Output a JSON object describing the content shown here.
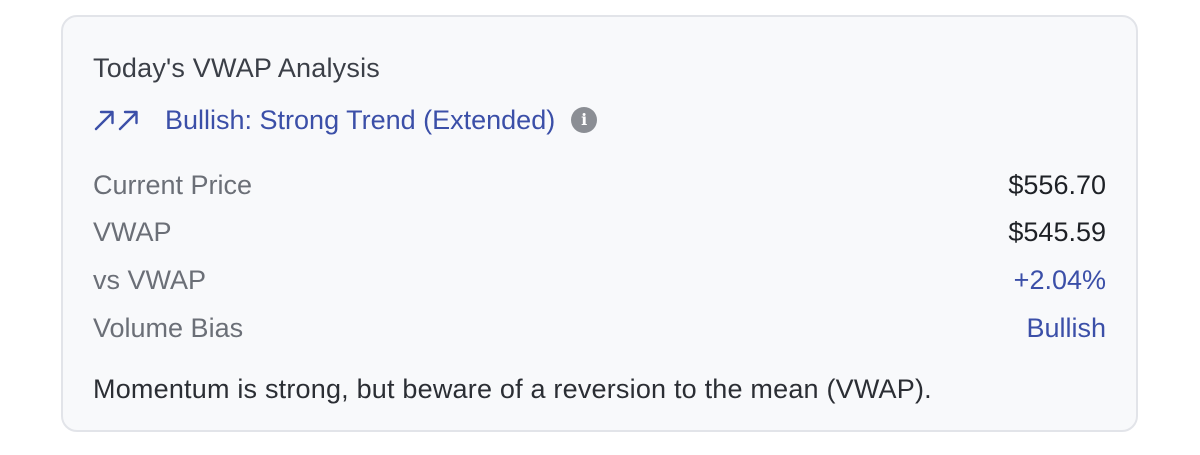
{
  "card": {
    "title": "Today's VWAP Analysis",
    "trend": {
      "icon": "double-arrow-up-right-icon",
      "label": "Bullish: Strong Trend (Extended)",
      "info_icon": "info-icon",
      "info_glyph": "i"
    },
    "metrics": [
      {
        "label": "Current Price",
        "value": "$556.70"
      },
      {
        "label": "VWAP",
        "value": "$545.59"
      },
      {
        "label": "vs VWAP",
        "value": "+2.04%"
      },
      {
        "label": "Volume Bias",
        "value": "Bullish"
      }
    ],
    "note": "Momentum is strong, but beware of a reversion to the mean (VWAP)."
  },
  "colors": {
    "accent": "#3b4fa8",
    "card_background": "#f8f9fb",
    "card_border": "#e2e4e9",
    "label_text": "#6b6f77",
    "value_text": "#1e2126",
    "info_icon_bg": "#8b8e94"
  }
}
